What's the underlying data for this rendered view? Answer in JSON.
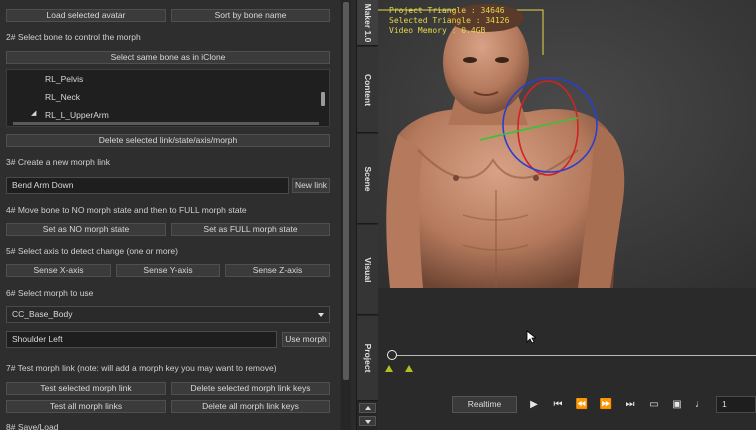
{
  "panel": {
    "load_avatar": "Load selected avatar",
    "sort_bone": "Sort by bone name",
    "step2": "2# Select bone to control the morph",
    "select_same_bone": "Select same bone as in iClone",
    "tree_items": [
      "RL_Pelvis",
      "RL_Neck",
      "RL_L_UpperArm"
    ],
    "delete_link": "Delete selected link/state/axis/morph",
    "step3": "3# Create a new morph link",
    "link_name": "Bend Arm Down",
    "new_link": "New link",
    "step4": "4# Move bone to NO morph state and then to FULL morph state",
    "set_no": "Set as NO morph state",
    "set_full": "Set as FULL morph state",
    "step5": "5# Select axis to detect change (one or more)",
    "sense_x": "Sense X-axis",
    "sense_y": "Sense Y-axis",
    "sense_z": "Sense Z-axis",
    "step6": "6# Select morph to use",
    "morph_select": "CC_Base_Body",
    "morph_name": "Shoulder Left",
    "use_morph": "Use morph",
    "step7": "7# Test morph link (note: will add a morph key you may want to remove)",
    "test_selected": "Test selected morph link",
    "delete_selected_keys": "Delete selected morph link keys",
    "test_all": "Test all morph links",
    "delete_all_keys": "Delete all morph link keys",
    "step8": "8# Save/Load"
  },
  "tabs": {
    "maker": "Maker 1.0",
    "content": "Content",
    "scene": "Scene",
    "visual": "Visual",
    "project": "Project"
  },
  "viewport": {
    "stat1": "Project Triangle : 34646",
    "stat2": "Selected Triangle : 34126",
    "stat3": "Video Memory : 0.4GB"
  },
  "timeline": {
    "realtime": "Realtime",
    "frame": "1",
    "icons": [
      "play-icon",
      "skip-start-icon",
      "rewind-icon",
      "fast-forward-icon",
      "skip-end-icon",
      "loop-icon",
      "caption-icon",
      "note-icon"
    ]
  },
  "colors": {
    "stats_text": "#e6d84a",
    "marker": "#b0c020",
    "gizmo_blue": "#2a3fd0",
    "gizmo_red": "#d02424",
    "gizmo_green": "#36c436"
  }
}
